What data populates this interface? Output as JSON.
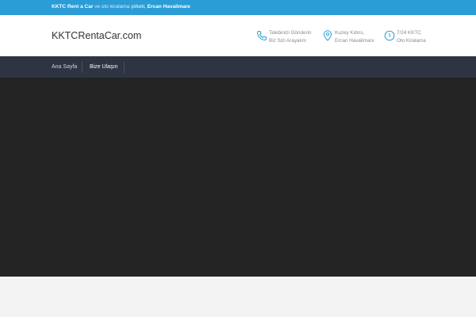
{
  "topbar": {
    "brand": "KKTC Rent a Car",
    "middle": " ve oto kiralama ",
    "company": "şirketi",
    "separator": ", ",
    "airport": "Ercan Havalimanı"
  },
  "header": {
    "logo": "KKTCRentaCar.com",
    "info": [
      {
        "icon": "phone-icon",
        "line1": "Talebinizi Gönderin",
        "line2": "Biz Sizi Arayalım"
      },
      {
        "icon": "map-pin-icon",
        "line1": "Kuzey Kıbrıs,",
        "line2": "Ercan Havalimanı"
      },
      {
        "icon": "clock-icon",
        "line1": "7/24 KKTC",
        "line2": "Oto Kiralama"
      }
    ]
  },
  "nav": {
    "items": [
      {
        "label": "Ana Sayfa"
      },
      {
        "label": "Bize Ulaşın"
      }
    ]
  },
  "colors": {
    "topbar": "#2a9cd6",
    "nav": "#2f3443",
    "hero": "#242424",
    "icon_accent": "#2a9cd6"
  }
}
